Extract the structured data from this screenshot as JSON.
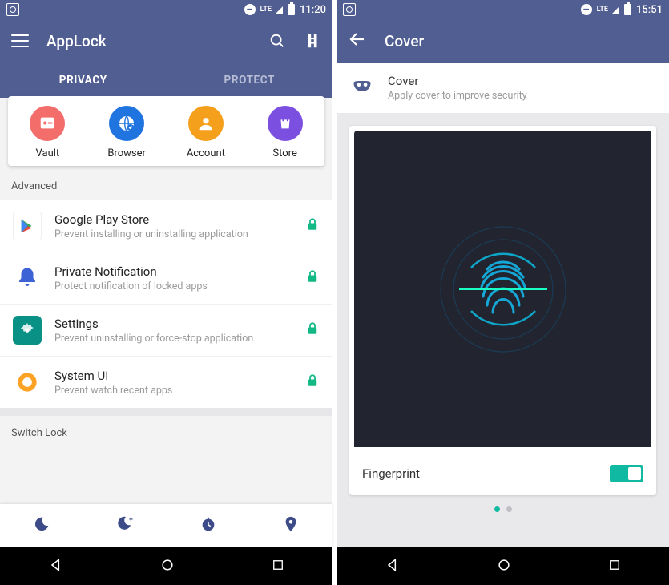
{
  "left": {
    "status": {
      "time": "11:20",
      "net": "LTE"
    },
    "app_title": "AppLock",
    "tabs": [
      {
        "label": "PRIVACY",
        "active": true
      },
      {
        "label": "PROTECT",
        "active": false
      }
    ],
    "shortcuts": [
      {
        "label": "Vault",
        "icon": "vault-icon",
        "bg": "#f36d6a"
      },
      {
        "label": "Browser",
        "icon": "browser-icon",
        "bg": "#1f74e0"
      },
      {
        "label": "Account",
        "icon": "account-icon",
        "bg": "#f5a01d"
      },
      {
        "label": "Store",
        "icon": "store-icon",
        "bg": "#7b4fe0"
      }
    ],
    "section_advanced": "Advanced",
    "rows": [
      {
        "icon": "play-store-icon",
        "title": "Google Play Store",
        "sub": "Prevent installing or uninstalling application",
        "locked": true
      },
      {
        "icon": "bell-icon",
        "title": "Private Notification",
        "sub": "Protect notification of locked apps",
        "locked": true
      },
      {
        "icon": "settings-icon",
        "title": "Settings",
        "sub": "Prevent uninstalling or force-stop application",
        "locked": true
      },
      {
        "icon": "system-ui-icon",
        "title": "System UI",
        "sub": "Prevent watch recent apps",
        "locked": true
      }
    ],
    "section_switch": "Switch Lock",
    "bottom_icons": [
      "moon-icon",
      "moon-plus-icon",
      "clock-icon",
      "location-icon"
    ]
  },
  "right": {
    "status": {
      "time": "15:51",
      "net": "LTE"
    },
    "app_title": "Cover",
    "header": {
      "title": "Cover",
      "sub": "Apply cover to improve security"
    },
    "card": {
      "label": "Fingerprint",
      "toggle_on": true
    },
    "page_dots": {
      "count": 2,
      "active": 0
    }
  }
}
